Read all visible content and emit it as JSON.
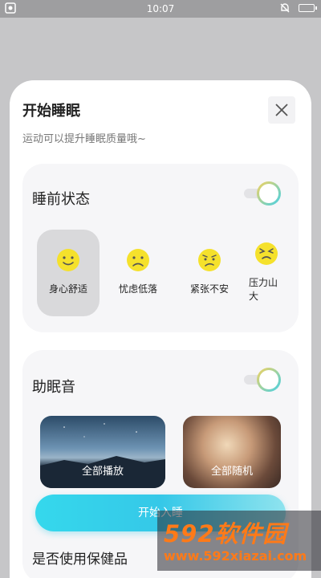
{
  "status_bar": {
    "time": "10:07",
    "left_icon": "notification-dot-icon",
    "right_icons": [
      "bell-off-icon",
      "battery-charging-icon"
    ]
  },
  "sheet": {
    "title": "开始睡眠",
    "subtitle": "运动可以提升睡眠质量哦~",
    "close_icon": "close-icon"
  },
  "pre_sleep": {
    "title": "睡前状态",
    "toggle_on": true,
    "moods": [
      {
        "label": "身心舒适",
        "icon": "smile-face-icon",
        "selected": true
      },
      {
        "label": "忧虑低落",
        "icon": "sad-face-icon",
        "selected": false
      },
      {
        "label": "紧张不安",
        "icon": "worried-face-icon",
        "selected": false
      },
      {
        "label": "压力山大",
        "icon": "stressed-face-icon",
        "selected": false
      }
    ]
  },
  "sleep_sound": {
    "title": "助眠音",
    "toggle_on": true,
    "options": [
      {
        "label": "全部播放"
      },
      {
        "label": "全部随机"
      }
    ]
  },
  "start_button": {
    "label": "开始入睡"
  },
  "next_card_title": "是否使用保健品",
  "watermark": {
    "brand": "592软件园",
    "url": "www.592xiazai.com"
  },
  "colors": {
    "accent": "#35d8ec",
    "face": "#f5e12c",
    "sheet": "#ffffff",
    "card": "#f6f6f8"
  }
}
